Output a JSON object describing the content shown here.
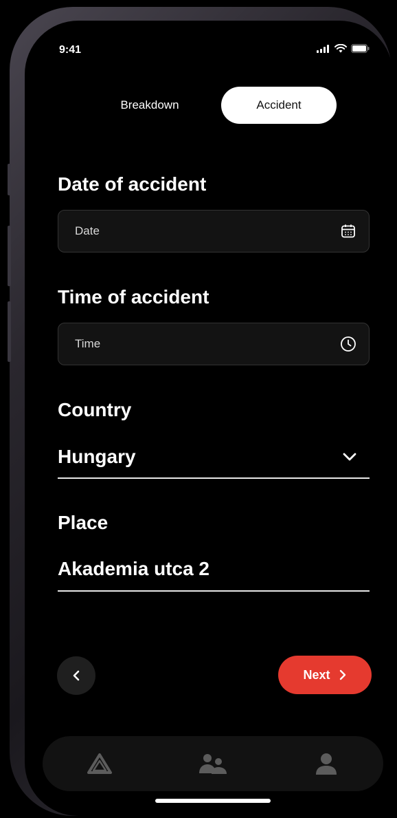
{
  "status_bar": {
    "time": "9:41"
  },
  "tabs": [
    {
      "label": "Breakdown",
      "active": false
    },
    {
      "label": "Accident",
      "active": true
    }
  ],
  "form": {
    "date": {
      "label": "Date of accident",
      "placeholder": "Date",
      "value": "",
      "icon": "calendar-icon"
    },
    "time": {
      "label": "Time of accident",
      "placeholder": "Time",
      "value": "",
      "icon": "clock-icon"
    },
    "country": {
      "label": "Country",
      "value": "Hungary",
      "icon": "chevron-down-icon"
    },
    "place": {
      "label": "Place",
      "value": "Akademia utca 2"
    }
  },
  "actions": {
    "next_label": "Next"
  },
  "colors": {
    "accent": "#e53a2f",
    "background": "#000000",
    "field_bg": "#131313"
  },
  "bottom_nav": [
    {
      "icon": "triangle-logo-icon"
    },
    {
      "icon": "people-icon"
    },
    {
      "icon": "user-icon"
    }
  ]
}
